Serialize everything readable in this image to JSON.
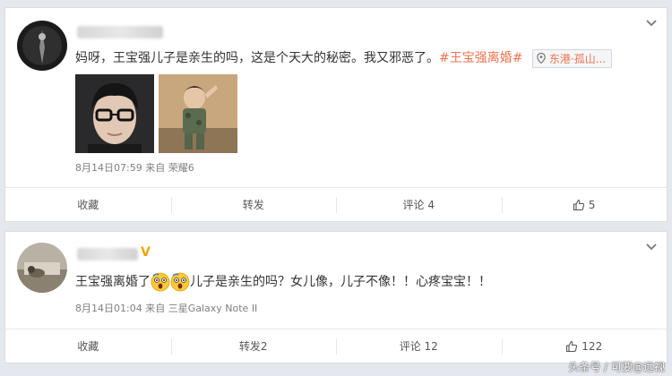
{
  "post1": {
    "text_main": "妈呀，王宝强儿子是亲生的吗，这是个天大的秘密。我又邪恶了。",
    "hashtag": "#王宝强离婚#",
    "location": "东港·孤山...",
    "meta_time": "8月14日07:59",
    "meta_from": "来自",
    "meta_device": "荣耀6",
    "actions": {
      "favorite": "收藏",
      "repost": "转发",
      "comment": "评论 4",
      "like_count": "5"
    }
  },
  "post2": {
    "text_before": "王宝强离婚了",
    "text_after": "儿子是亲生的吗？女儿像，儿子不像！！心疼宝宝！！",
    "meta_time": "8月14日01:04",
    "meta_from": "来自",
    "meta_device": "三星Galaxy Note II",
    "actions": {
      "favorite": "收藏",
      "repost": "转发2",
      "comment": "评论 12",
      "like_count": "122"
    }
  },
  "watermark": "头条号 / 可要@远视",
  "colors": {
    "tag": "#eb7350",
    "meta": "#808080",
    "background": "#e4e8ee"
  }
}
